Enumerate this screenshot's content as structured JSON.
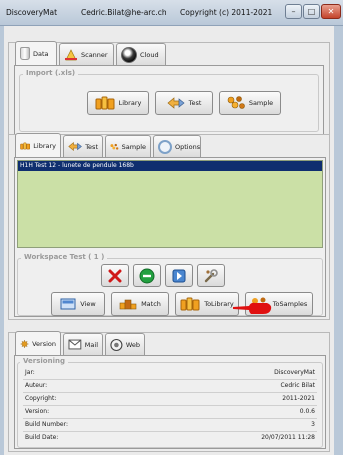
{
  "window": {
    "app_name": "DiscoveryMat",
    "user_email": "Cedric.Bilat@he-arc.ch",
    "copyright": "Copyright (c) 2011-2021"
  },
  "top_tabs": [
    "Data",
    "Scanner",
    "Cloud"
  ],
  "import_group": {
    "title": "Import (.xls)",
    "buttons": [
      "Library",
      "Test",
      "Sample"
    ]
  },
  "workspace_tabs": [
    "Library",
    "Test",
    "Sample",
    "Options"
  ],
  "test_list": {
    "items": [
      "H1H Test 12 - lunete de pendule 168b"
    ]
  },
  "workspace_group": {
    "title": "Workspace Test ( 1 )",
    "buttons": [
      "View",
      "Match",
      "ToLibrary",
      "ToSamples"
    ]
  },
  "bottom_tabs": [
    "Version",
    "Mail",
    "Web"
  ],
  "version_group": {
    "title": "Versioning",
    "rows": [
      {
        "label": "Jar:",
        "value": "DiscoveryMat"
      },
      {
        "label": "Auteur:",
        "value": "Cedric Bilat"
      },
      {
        "label": "Copyright:",
        "value": "2011-2021"
      },
      {
        "label": "Version:",
        "value": "0.0.6"
      },
      {
        "label": "Build Number:",
        "value": "3"
      },
      {
        "label": "Build Date:",
        "value": "20/07/2011 11:28"
      }
    ]
  },
  "colors": {
    "list_background": "#cbe0a6",
    "selection": "#0f2e6f",
    "annotation_hand": "#e01010"
  }
}
